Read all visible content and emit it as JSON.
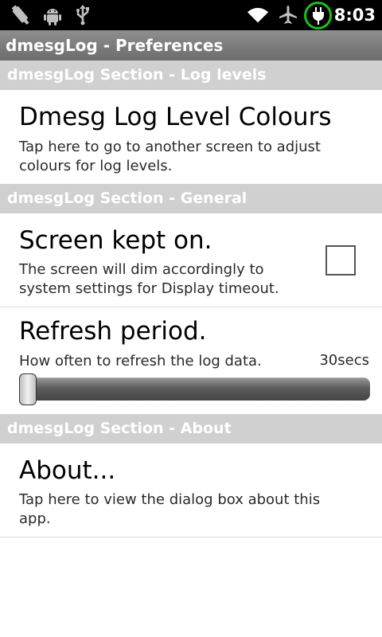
{
  "status_bar": {
    "time": "8:03",
    "icons": [
      "usb-debug-icon",
      "android-debug-icon",
      "usb-icon",
      "wifi-icon",
      "airplane-icon",
      "charging-icon"
    ],
    "charging_ring_color": "#19c119"
  },
  "app": {
    "title": "dmesgLog - Preferences"
  },
  "sections": [
    {
      "header": "dmesgLog Section - Log levels",
      "items": [
        {
          "title": "Dmesg Log Level Colours",
          "summary": "Tap here to go to another screen to adjust colours for log levels."
        }
      ]
    },
    {
      "header": "dmesgLog Section - General",
      "items": [
        {
          "title": "Screen kept on.",
          "summary": "The screen will dim accordingly to system settings for Display timeout.",
          "checked": false
        },
        {
          "title": "Refresh period.",
          "summary": "How often to refresh the log data.",
          "value_label": "30secs",
          "slider_fraction": 0.0
        }
      ]
    },
    {
      "header": "dmesgLog Section - About",
      "items": [
        {
          "title": "About...",
          "summary": "Tap here to view the dialog box about this app."
        }
      ]
    }
  ],
  "colors": {
    "section_header_bg": "#d0d0d0",
    "title_bar_bg": "#7c7c7c",
    "status_bar_bg": "#000000"
  }
}
